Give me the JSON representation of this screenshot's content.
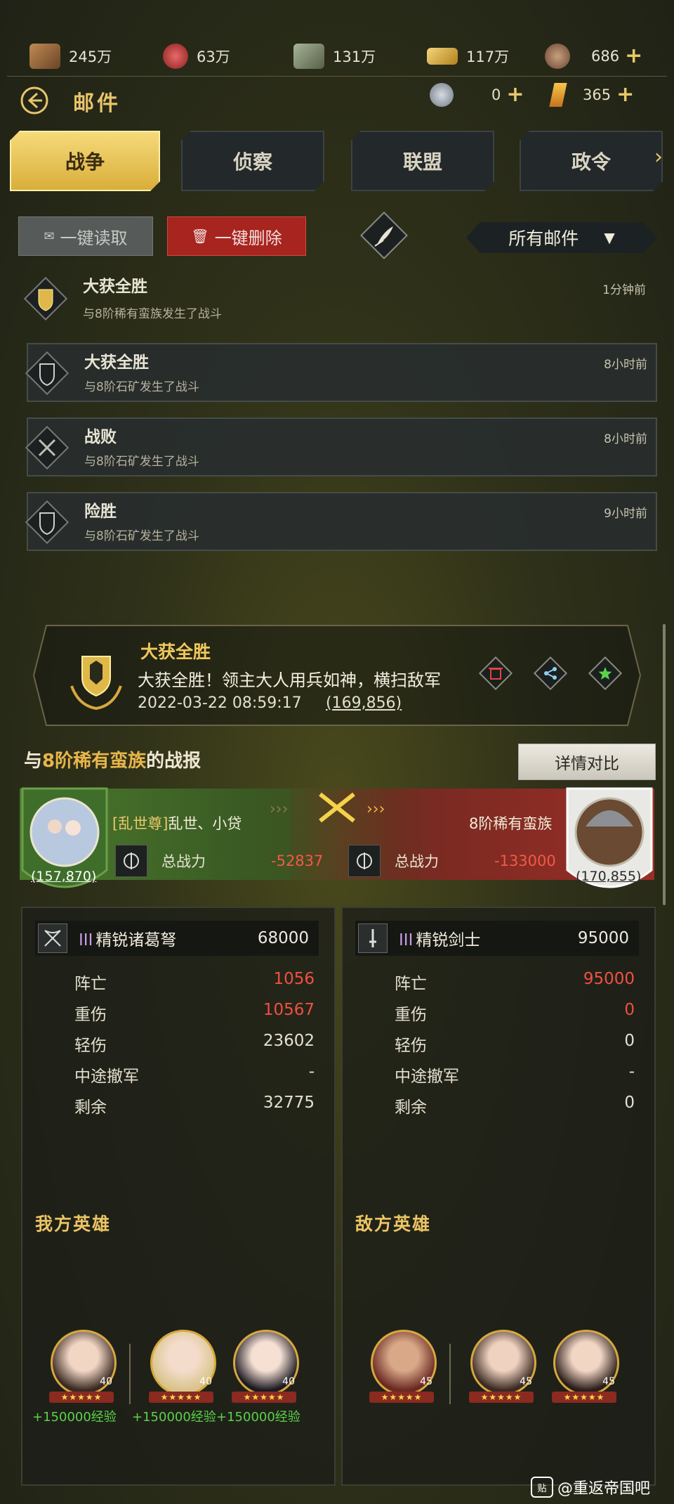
{
  "resources": [
    {
      "icon": "wood-icon",
      "value": "245万",
      "color": "#8a5a30"
    },
    {
      "icon": "meat-icon",
      "value": "63万",
      "color": "#c23a3a"
    },
    {
      "icon": "stone-icon",
      "value": "131万",
      "color": "#7c8a6a"
    },
    {
      "icon": "gold-bar-icon",
      "value": "117万",
      "color": "#d4a83a"
    },
    {
      "icon": "coin-icon",
      "value": "686",
      "color": "#a0765a"
    }
  ],
  "secondary_resources": [
    {
      "icon": "silver-coin-icon",
      "value": "0"
    },
    {
      "icon": "crystal-icon",
      "value": "365"
    }
  ],
  "plus": "+",
  "header": {
    "title": "邮件"
  },
  "tabs": [
    "战争",
    "侦察",
    "联盟",
    "政令"
  ],
  "actions": {
    "read_all": "一键读取",
    "delete_all": "一键删除",
    "filter": "所有邮件"
  },
  "mails": [
    {
      "title": "大获全胜",
      "sub": "与8阶稀有蛮族发生了战斗",
      "time": "1分钟前"
    },
    {
      "title": "大获全胜",
      "sub": "与8阶石矿发生了战斗",
      "time": "8小时前"
    },
    {
      "title": "战败",
      "sub": "与8阶石矿发生了战斗",
      "time": "8小时前"
    },
    {
      "title": "险胜",
      "sub": "与8阶石矿发生了战斗",
      "time": "9小时前"
    }
  ],
  "report": {
    "title": "大获全胜",
    "text": "大获全胜！领主大人用兵如神，横扫敌军",
    "time": "2022-03-22 08:59:17",
    "power": "(169,856)",
    "section_prefix": "与",
    "section_highlight": "8阶稀有蛮族",
    "section_suffix": "的战报",
    "detail_button": "详情对比"
  },
  "versus": {
    "left": {
      "tag": "[乱世尊]",
      "name": "乱世、小贷",
      "power_label": "总战力",
      "power_value": "-52837",
      "level": "(157,870)"
    },
    "right": {
      "name": "8阶稀有蛮族",
      "power_label": "总战力",
      "power_value": "-133000",
      "level": "(170,855)"
    }
  },
  "left_panel": {
    "unit_rank": "III",
    "unit_name": "精锐诸葛弩",
    "unit_value": "68000",
    "stats": [
      {
        "label": "阵亡",
        "value": "1056"
      },
      {
        "label": "重伤",
        "value": "10567"
      },
      {
        "label": "轻伤",
        "value": "23602"
      },
      {
        "label": "中途撤军",
        "value": "-"
      },
      {
        "label": "剩余",
        "value": "32775"
      }
    ],
    "heroes_title": "我方英雄",
    "heroes": [
      {
        "level": "40",
        "stars": "★★★★★",
        "exp": "+150000经验"
      },
      {
        "level": "40",
        "stars": "★★★★★",
        "exp": "+150000经验"
      },
      {
        "level": "40",
        "stars": "★★★★★",
        "exp": "+150000经验"
      }
    ]
  },
  "right_panel": {
    "unit_rank": "III",
    "unit_name": "精锐剑士",
    "unit_value": "95000",
    "stats": [
      {
        "label": "阵亡",
        "value": "95000"
      },
      {
        "label": "重伤",
        "value": "0"
      },
      {
        "label": "轻伤",
        "value": "0"
      },
      {
        "label": "中途撤军",
        "value": "-"
      },
      {
        "label": "剩余",
        "value": "0"
      }
    ],
    "heroes_title": "敌方英雄",
    "heroes": [
      {
        "level": "45",
        "stars": "★★★★★"
      },
      {
        "level": "45",
        "stars": "★★★★★"
      },
      {
        "level": "45",
        "stars": "★★★★★"
      }
    ]
  },
  "watermark": {
    "logo": "贴",
    "text": "@重返帝国吧"
  }
}
